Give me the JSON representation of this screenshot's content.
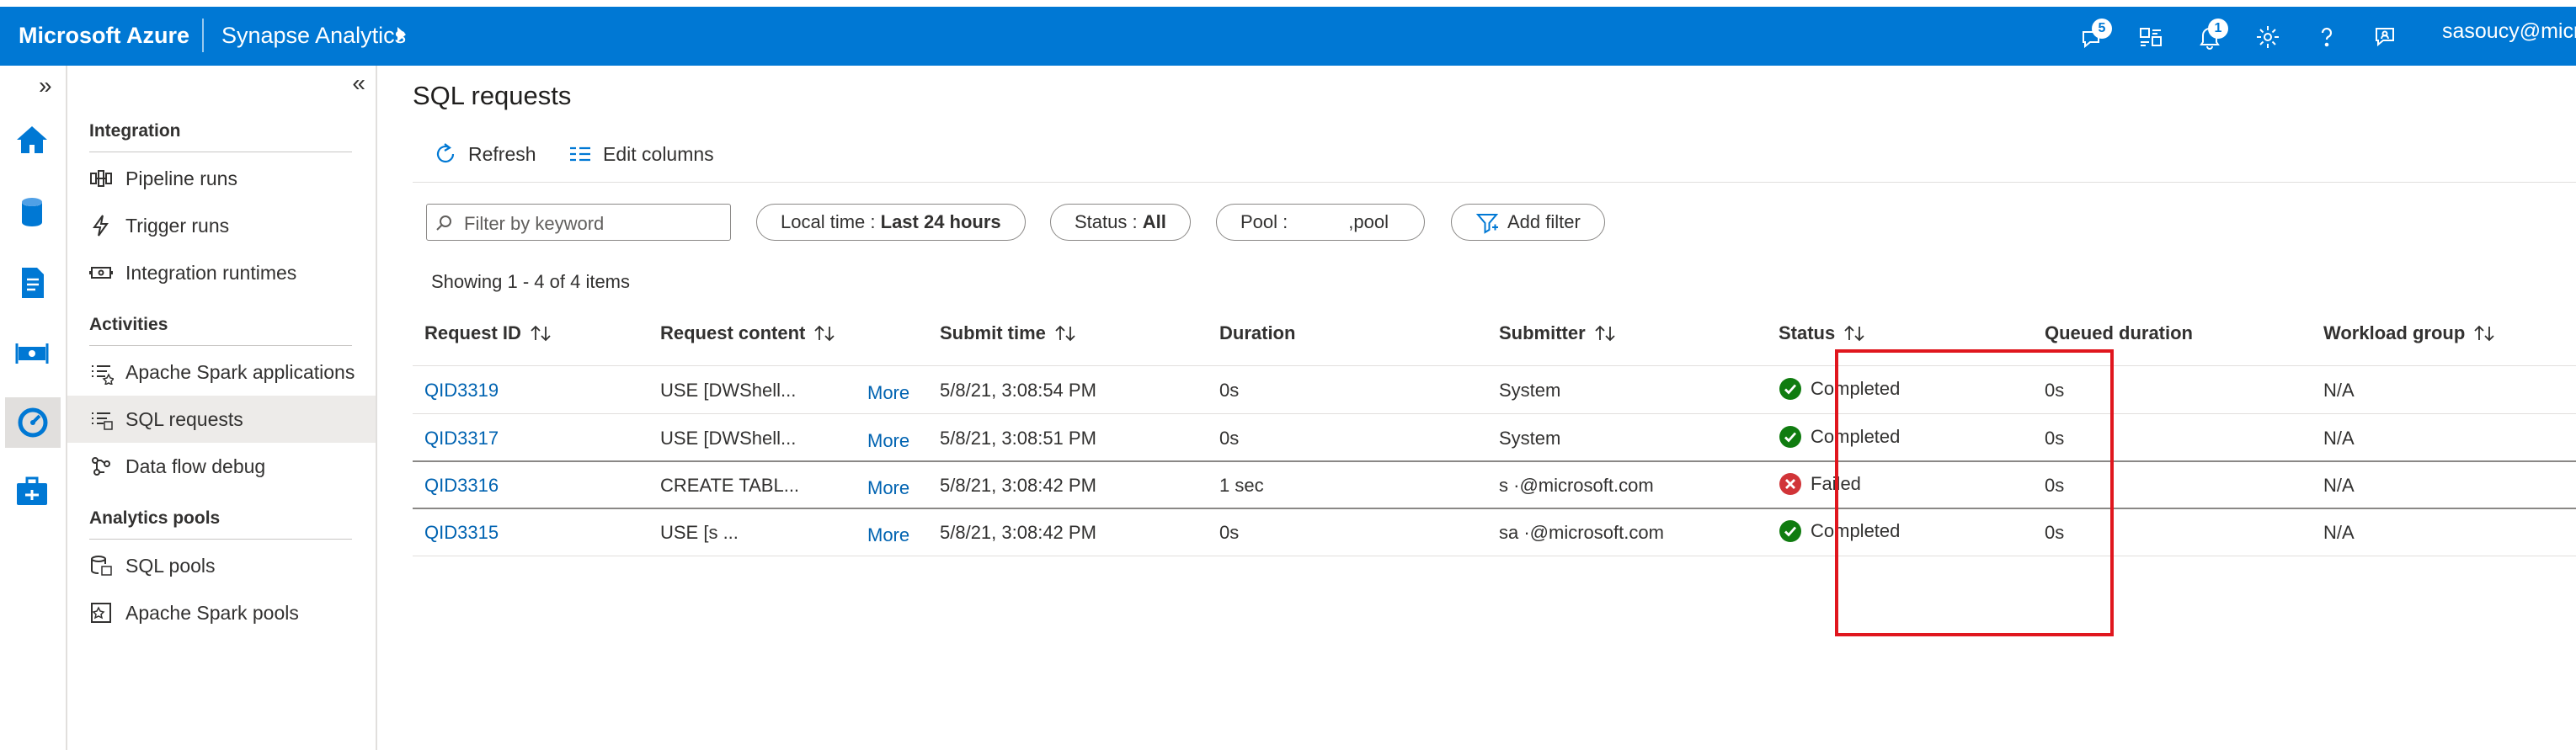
{
  "topbar": {
    "brand": "Microsoft Azure",
    "service": "Synapse Analytics",
    "notifications_badge": "5",
    "alerts_badge": "1",
    "user": "sasoucy@micr",
    "accent": "#0078d4"
  },
  "nav": {
    "groups": {
      "integration": "Integration",
      "activities": "Activities",
      "analytics_pools": "Analytics pools"
    },
    "items": {
      "pipeline_runs": "Pipeline runs",
      "trigger_runs": "Trigger runs",
      "integration_runtimes": "Integration runtimes",
      "spark_applications": "Apache Spark applications",
      "sql_requests": "SQL requests",
      "data_flow_debug": "Data flow debug",
      "sql_pools": "SQL pools",
      "spark_pools": "Apache Spark pools"
    },
    "collapse_glyph": "«",
    "expand_glyph": "»"
  },
  "page": {
    "title": "SQL requests",
    "refresh": "Refresh",
    "edit_columns": "Edit columns",
    "search_placeholder": "Filter by keyword",
    "filters": {
      "time_label": "Local time : ",
      "time_value": "Last 24 hours",
      "status_label": "Status : ",
      "status_value": "All",
      "pool_label": "Pool : ",
      "pool_value": ",pool",
      "add_filter": "Add filter"
    },
    "showing": "Showing 1 - 4 of 4 items",
    "columns": {
      "request_id": "Request ID",
      "request_content": "Request content",
      "submit_time": "Submit time",
      "duration": "Duration",
      "submitter": "Submitter",
      "status": "Status",
      "queued_duration": "Queued duration",
      "workload_group": "Workload group"
    },
    "rows": [
      {
        "id": "QID3319",
        "content": "USE [DWShell...",
        "more": "More",
        "submit": "5/8/21, 3:08:54 PM",
        "duration": "0s",
        "submitter": "System",
        "status": "Completed",
        "queued": "0s",
        "workload": "N/A"
      },
      {
        "id": "QID3317",
        "content": "USE [DWShell...",
        "more": "More",
        "submit": "5/8/21, 3:08:51 PM",
        "duration": "0s",
        "submitter": "System",
        "status": "Completed",
        "queued": "0s",
        "workload": "N/A"
      },
      {
        "id": "QID3316",
        "content": "CREATE TABL...",
        "more": "More",
        "submit": "5/8/21, 3:08:42 PM",
        "duration": "1 sec",
        "submitter": "s         ·@microsoft.com",
        "status": "Failed",
        "queued": "0s",
        "workload": "N/A"
      },
      {
        "id": "QID3315",
        "content": "USE [s           ...",
        "more": "More",
        "submit": "5/8/21, 3:08:42 PM",
        "duration": "0s",
        "submitter": "sa        ·@microsoft.com",
        "status": "Completed",
        "queued": "0s",
        "workload": "N/A"
      }
    ]
  },
  "colors": {
    "success": "#107c10",
    "error": "#d13438",
    "link": "#0063b1",
    "highlight": "#e0161e"
  }
}
